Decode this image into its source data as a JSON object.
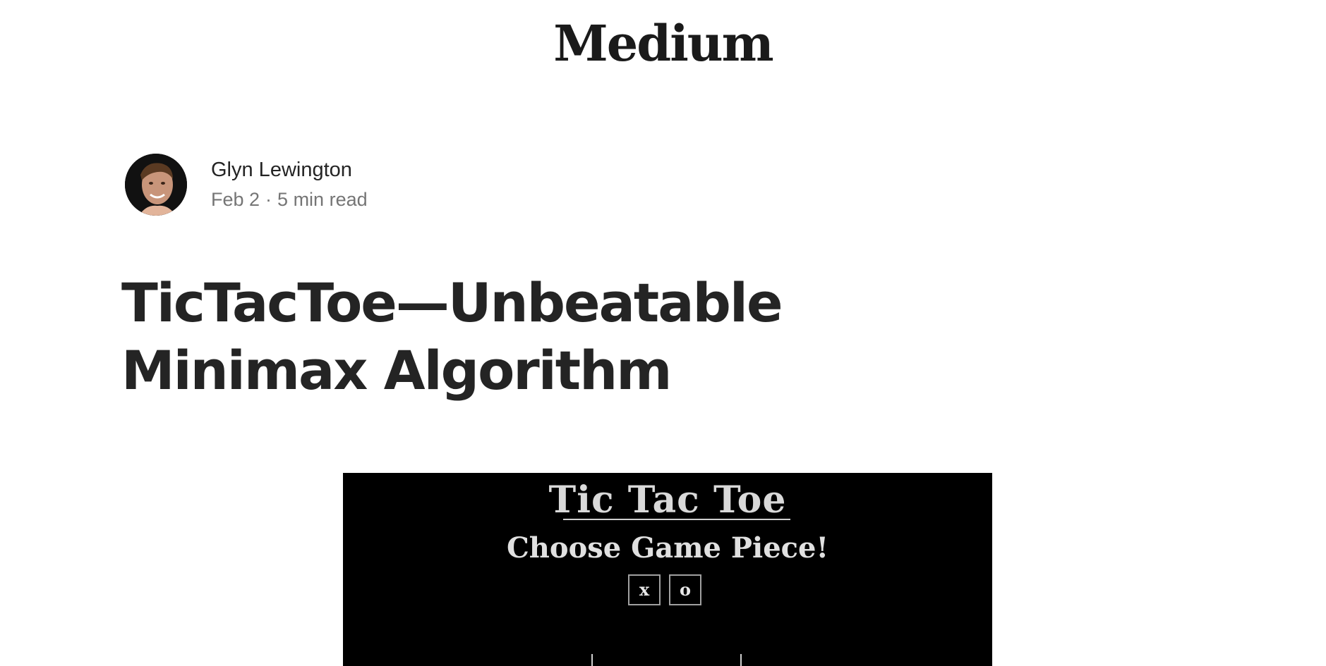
{
  "site": {
    "logo": "Medium"
  },
  "author": {
    "name": "Glyn Lewington",
    "date": "Feb 2",
    "separator": "·",
    "read_time": "5 min read"
  },
  "article": {
    "title": "TicTacToe—Unbeatable Minimax Algorithm"
  },
  "game": {
    "title": "Tic Tac Toe",
    "subtitle": "Choose Game Piece!",
    "pieces": [
      "x",
      "o"
    ]
  },
  "colors": {
    "text_primary": "#242424",
    "text_secondary": "#757575",
    "game_background": "#000000"
  }
}
